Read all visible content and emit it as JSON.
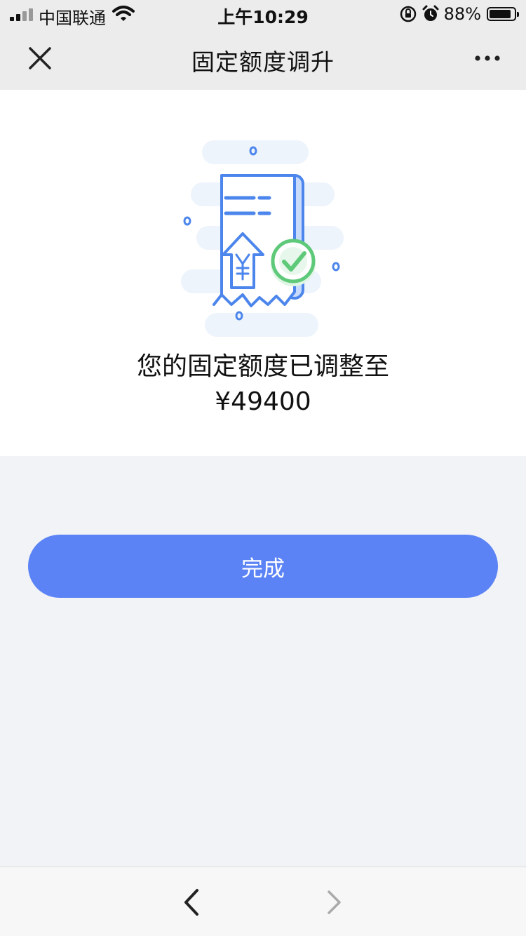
{
  "status_bar": {
    "carrier": "中国联通",
    "time": "上午10:29",
    "battery_percent": "88%",
    "battery_level": 0.88,
    "icons": [
      "signal-icon",
      "wifi-icon",
      "orientation-lock-icon",
      "alarm-icon",
      "battery-icon"
    ]
  },
  "nav": {
    "title": "固定额度调升",
    "close_icon": "close-icon",
    "more_icon": "more-icon"
  },
  "result": {
    "illustration_icon": "receipt-approved-icon",
    "message": "您的固定额度已调整至",
    "amount": "¥49400"
  },
  "actions": {
    "done_label": "完成"
  },
  "toolbar": {
    "back_icon": "chevron-left-icon",
    "forward_icon": "chevron-right-icon"
  },
  "colors": {
    "accent": "#5b83f5",
    "success": "#5fc97a",
    "page_background": "#f2f3f7",
    "bar_background": "#ececec"
  }
}
